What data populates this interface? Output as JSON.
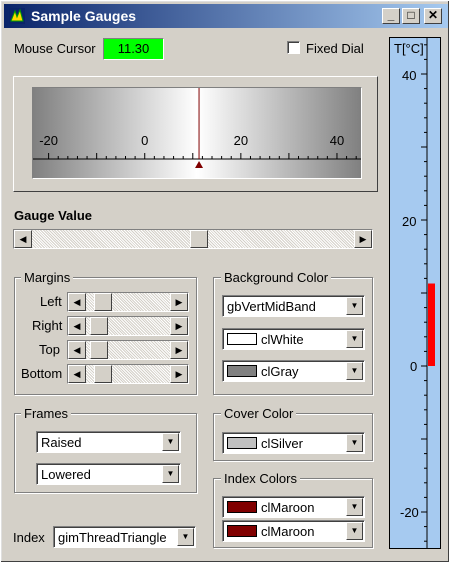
{
  "window": {
    "title": "Sample Gauges",
    "minimize": "_",
    "maximize": "□",
    "close": "✕"
  },
  "mouse_cursor": {
    "label": "Mouse Cursor",
    "value": "11.30"
  },
  "fixed_dial": {
    "label": "Fixed Dial",
    "checked": false
  },
  "dial": {
    "ticks": [
      "-20",
      "0",
      "20",
      "40"
    ],
    "range": [
      -30,
      45
    ],
    "pointer": 11.3,
    "bar_color": "#800000"
  },
  "gauge_value": {
    "label": "Gauge Value",
    "value": 11.3
  },
  "margins": {
    "title": "Margins",
    "items": [
      {
        "label": "Left"
      },
      {
        "label": "Right"
      },
      {
        "label": "Top"
      },
      {
        "label": "Bottom"
      }
    ]
  },
  "background_color": {
    "title": "Background Color",
    "style": "gbVertMidBand",
    "color1": {
      "name": "clWhite",
      "hex": "#ffffff"
    },
    "color2": {
      "name": "clGray",
      "hex": "#808080"
    }
  },
  "frames": {
    "title": "Frames",
    "outer": "Raised",
    "inner": "Lowered"
  },
  "cover_color": {
    "title": "Cover Color",
    "color": {
      "name": "clSilver",
      "hex": "#c0c0c0"
    }
  },
  "index_colors": {
    "title": "Index Colors",
    "color1": {
      "name": "clMaroon",
      "hex": "#800000"
    },
    "color2": {
      "name": "clMaroon",
      "hex": "#800000"
    }
  },
  "index": {
    "label": "Index",
    "value": "gimThreadTriangle"
  },
  "thermometer": {
    "title": "T[°C]",
    "labels": [
      "40",
      "20",
      "0",
      "-20"
    ],
    "value": 11.3,
    "range": [
      -25,
      45
    ],
    "fill": "#ff0000",
    "bg": "#a6caf0"
  }
}
